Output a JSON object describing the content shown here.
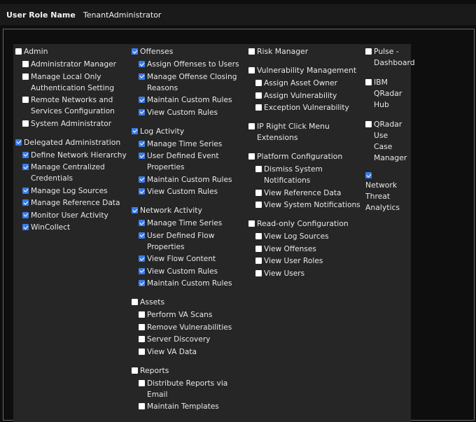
{
  "header": {
    "label": "User Role Name",
    "value": "TenantAdministrator"
  },
  "columns": [
    [
      {
        "label": "Admin",
        "checked": false,
        "children": [
          {
            "label": "Administrator Manager",
            "checked": false
          },
          {
            "label": "Manage Local Only Authentication Setting",
            "checked": false
          },
          {
            "label": "Remote Networks and Services Configuration",
            "checked": false
          },
          {
            "label": "System Administrator",
            "checked": false
          }
        ]
      },
      {
        "label": "Delegated Administration",
        "checked": true,
        "children": [
          {
            "label": "Define Network Hierarchy",
            "checked": true
          },
          {
            "label": "Manage Centralized Credentials",
            "checked": true
          },
          {
            "label": "Manage Log Sources",
            "checked": true
          },
          {
            "label": "Manage Reference Data",
            "checked": true
          },
          {
            "label": "Monitor User Activity",
            "checked": true
          },
          {
            "label": "WinCollect",
            "checked": true
          }
        ]
      }
    ],
    [
      {
        "label": "Offenses",
        "checked": true,
        "children": [
          {
            "label": "Assign Offenses to Users",
            "checked": true
          },
          {
            "label": "Manage Offense Closing Reasons",
            "checked": true
          },
          {
            "label": "Maintain Custom Rules",
            "checked": true
          },
          {
            "label": "View Custom Rules",
            "checked": true
          }
        ]
      },
      {
        "label": "Log Activity",
        "checked": true,
        "children": [
          {
            "label": "Manage Time Series",
            "checked": true
          },
          {
            "label": "User Defined Event Properties",
            "checked": true
          },
          {
            "label": "Maintain Custom Rules",
            "checked": true
          },
          {
            "label": "View Custom Rules",
            "checked": true
          }
        ]
      },
      {
        "label": "Network Activity",
        "checked": true,
        "children": [
          {
            "label": "Manage Time Series",
            "checked": true
          },
          {
            "label": "User Defined Flow Properties",
            "checked": true
          },
          {
            "label": "View Flow Content",
            "checked": true
          },
          {
            "label": "View Custom Rules",
            "checked": true
          },
          {
            "label": "Maintain Custom Rules",
            "checked": true
          }
        ]
      },
      {
        "label": "Assets",
        "checked": false,
        "children": [
          {
            "label": "Perform VA Scans",
            "checked": false
          },
          {
            "label": "Remove Vulnerabilities",
            "checked": false
          },
          {
            "label": "Server Discovery",
            "checked": false
          },
          {
            "label": "View VA Data",
            "checked": false
          }
        ]
      },
      {
        "label": "Reports",
        "checked": false,
        "children": [
          {
            "label": "Distribute Reports via Email",
            "checked": false
          },
          {
            "label": "Maintain Templates",
            "checked": false
          }
        ]
      }
    ],
    [
      {
        "label": "Risk Manager",
        "checked": false,
        "children": []
      },
      {
        "label": "Vulnerability Management",
        "checked": false,
        "children": [
          {
            "label": "Assign Asset Owner",
            "checked": false
          },
          {
            "label": "Assign Vulnerability",
            "checked": false
          },
          {
            "label": "Exception Vulnerability",
            "checked": false
          }
        ]
      },
      {
        "label": "IP Right Click Menu Extensions",
        "checked": false,
        "children": []
      },
      {
        "label": "Platform Configuration",
        "checked": false,
        "children": [
          {
            "label": "Dismiss System Notifications",
            "checked": false
          },
          {
            "label": "View Reference Data",
            "checked": false
          },
          {
            "label": "View System Notifications",
            "checked": false
          }
        ]
      },
      {
        "label": "Read-only Configuration",
        "checked": false,
        "children": [
          {
            "label": "View Log Sources",
            "checked": false
          },
          {
            "label": "View Offenses",
            "checked": false
          },
          {
            "label": "View User Roles",
            "checked": false
          },
          {
            "label": "View Users",
            "checked": false
          }
        ]
      }
    ],
    [
      {
        "label": "Pulse - Dashboard",
        "checked": false,
        "children": []
      },
      {
        "label": "IBM QRadar Hub",
        "checked": false,
        "children": []
      },
      {
        "label": "QRadar Use Case Manager",
        "checked": false,
        "children": []
      },
      {
        "label": "Network Threat Analytics",
        "checked": true,
        "stacked": true,
        "children": []
      }
    ]
  ]
}
